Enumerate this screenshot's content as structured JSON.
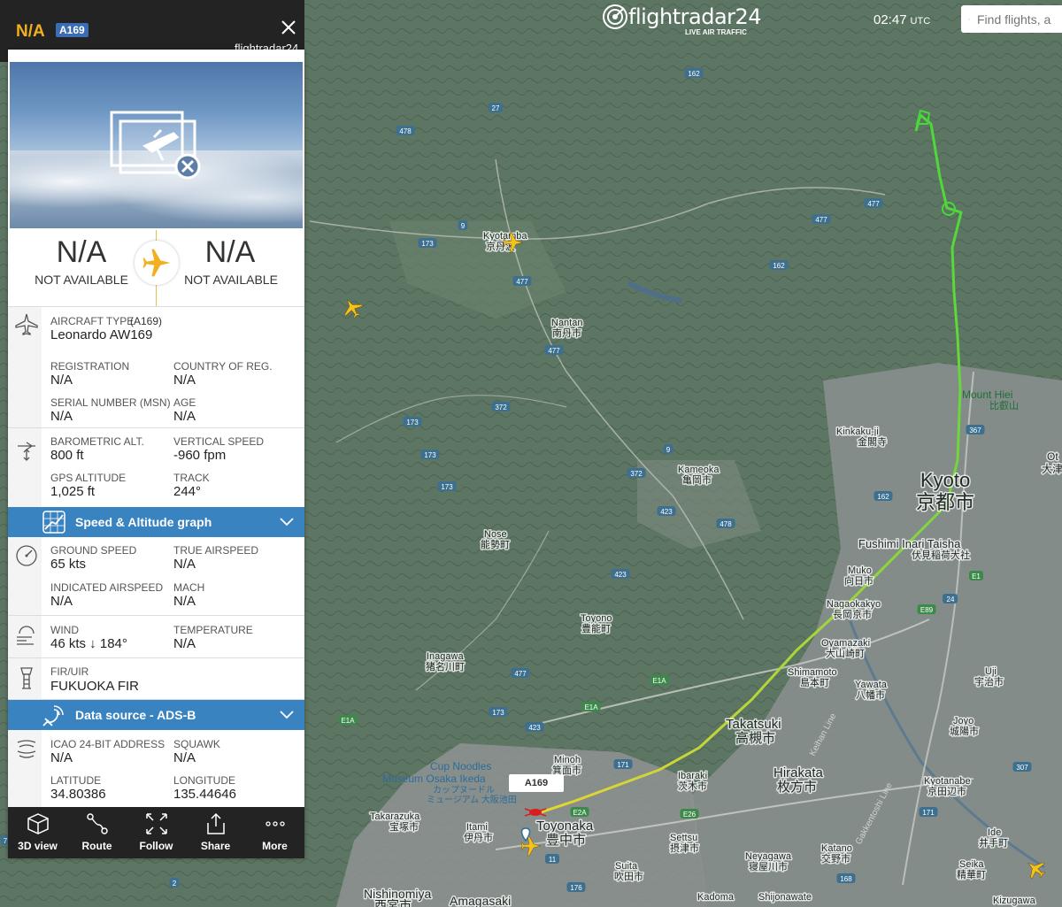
{
  "header": {
    "logo_text": "flightradar24",
    "logo_subtitle": "LIVE AIR TRAFFIC",
    "time": "02:47",
    "timezone": "UTC",
    "search_placeholder": "Find flights, a"
  },
  "panel": {
    "registration": "N/A",
    "type_badge": "A169",
    "brand": "flightradar24",
    "origin": {
      "code": "N/A",
      "name": "NOT AVAILABLE"
    },
    "destination": {
      "code": "N/A",
      "name": "NOT AVAILABLE"
    },
    "aircraft": {
      "type_label": "AIRCRAFT TYPE",
      "type_code": "(A169)",
      "type_value": "Leonardo AW169",
      "registration_label": "REGISTRATION",
      "registration_value": "N/A",
      "country_label": "COUNTRY OF REG.",
      "country_value": "N/A",
      "serial_label": "SERIAL NUMBER (MSN)",
      "serial_value": "N/A",
      "age_label": "AGE",
      "age_value": "N/A"
    },
    "altitude": {
      "baro_label": "BAROMETRIC ALT.",
      "baro_value": "800 ft",
      "vspeed_label": "VERTICAL SPEED",
      "vspeed_value": "-960 fpm",
      "gps_label": "GPS ALTITUDE",
      "gps_value": "1,025 ft",
      "track_label": "TRACK",
      "track_value": "244°"
    },
    "speed_graph_title": "Speed & Altitude graph",
    "speed": {
      "ground_label": "GROUND SPEED",
      "ground_value": "65 kts",
      "tas_label": "TRUE AIRSPEED",
      "tas_value": "N/A",
      "ias_label": "INDICATED AIRSPEED",
      "ias_value": "N/A",
      "mach_label": "MACH",
      "mach_value": "N/A"
    },
    "wind": {
      "wind_label": "WIND",
      "wind_value": "46 kts ↓ 184°",
      "temp_label": "TEMPERATURE",
      "temp_value": "N/A"
    },
    "fir": {
      "label": "FIR/UIR",
      "value": "FUKUOKA FIR"
    },
    "data_source_title": "Data source - ADS-B",
    "icao": {
      "addr_label": "ICAO 24-BIT ADDRESS",
      "addr_value": "N/A",
      "squawk_label": "SQUAWK",
      "squawk_value": "N/A",
      "lat_label": "LATITUDE",
      "lat_value": "34.80386",
      "lon_label": "LONGITUDE",
      "lon_value": "135.44646"
    },
    "bottom_bar": [
      {
        "label": "3D view",
        "icon": "cube-icon"
      },
      {
        "label": "Route",
        "icon": "route-icon"
      },
      {
        "label": "Follow",
        "icon": "follow-icon"
      },
      {
        "label": "Share",
        "icon": "share-icon"
      },
      {
        "label": "More",
        "icon": "more-icon"
      }
    ]
  },
  "map": {
    "aircraft_callout": "A169",
    "places": {
      "kyoto_en": "Kyoto",
      "kyoto_jp": "京都市",
      "kyotamba_en": "Kyotamba",
      "kyotamba_jp": "京丹波",
      "nantan_en": "Nantan",
      "nantan_jp": "南丹市",
      "kameoka_en": "Kameoka",
      "kameoka_jp": "亀岡市",
      "nose_en": "Nose",
      "nose_jp": "能勢町",
      "toyono_en": "Toyono",
      "toyono_jp": "豊能町",
      "inagawa_en": "Inagawa",
      "inagawa_jp": "猪名川町",
      "minoh_en": "Minoh",
      "minoh_jp": "箕面市",
      "ibaraki_en": "Ibaraki",
      "ibaraki_jp": "茨木市",
      "takatsuki_en": "Takatsuki",
      "takatsuki_jp": "高槻市",
      "hirakata_en": "Hirakata",
      "hirakata_jp": "枚方市",
      "shimamoto_en": "Shimamoto",
      "shimamoto_jp": "島本町",
      "oyamazaki_en": "Oyamazaki",
      "oyamazaki_jp": "大山崎町",
      "nagaokakyo_en": "Nagaokakyo",
      "nagaokakyo_jp": "長岡京市",
      "muko_en": "Muko",
      "muko_jp": "向日市",
      "yawata_en": "Yawata",
      "yawata_jp": "八幡市",
      "joyo_en": "Joyo",
      "joyo_jp": "城陽市",
      "uji_en": "Uji",
      "uji_jp": "宇治市",
      "kotanabe_en": "Kyotanabe",
      "kotanabe_jp": "京田辺市",
      "ide_en": "Ide",
      "ide_jp": "井手町",
      "seika_en": "Seika",
      "seika_jp": "精華町",
      "kizugawa_en": "Kizugawa",
      "toyonaka_en": "Toyonaka",
      "toyonaka_jp": "豊中市",
      "itami_en": "Itami",
      "itami_jp": "伊丹市",
      "takarazuka_en": "Takarazuka",
      "takarazuka_jp": "宝塚市",
      "settsu_en": "Settsu",
      "settsu_jp": "摂津市",
      "suita_en": "Suita",
      "suita_jp": "吹田市",
      "neyagawa_en": "Neyagawa",
      "neyagawa_jp": "寝屋川市",
      "katano_en": "Katano",
      "katano_jp": "交野市",
      "kadoma_en": "Kadoma",
      "shijonawate_en": "Shijonawate",
      "nishinomiya_en": "Nishinomiya",
      "nishinomiya_jp": "西宮市",
      "amagasaki_en": "Amagasaki",
      "kinkakuji_en": "Kinkaku-ji",
      "kinkakuji_jp": "金閣寺",
      "fushimi_en": "Fushimi Inari Taisha",
      "fushimi_jp": "伏見稲荷大社",
      "mounthiei_en": "Mount Hiei",
      "mounthiei_jp": "比叡山",
      "cupnoodles_en1": "Cup Noodles",
      "cupnoodles_en2": "Museum Osaka Ikeda",
      "cupnoodles_jp1": "カップヌードル",
      "cupnoodles_jp2": "ミュージアム 大阪池田",
      "otsu_en": "Ot",
      "otsu_jp": "大津",
      "kenan_line": "Keihan Line",
      "gakken_line": "Gakkentoshi Line"
    },
    "road_numbers": [
      "162",
      "27",
      "478",
      "173",
      "9",
      "477",
      "162",
      "477",
      "477",
      "372",
      "477",
      "173",
      "173",
      "173",
      "372",
      "9",
      "423",
      "367",
      "162",
      "24",
      "478",
      "423",
      "477",
      "173",
      "423",
      "171",
      "E1A",
      "E1A",
      "E2A",
      "E26",
      "11",
      "176",
      "171",
      "168",
      "307",
      "24",
      "E1",
      "E89",
      "2",
      "7",
      "E1A"
    ]
  }
}
